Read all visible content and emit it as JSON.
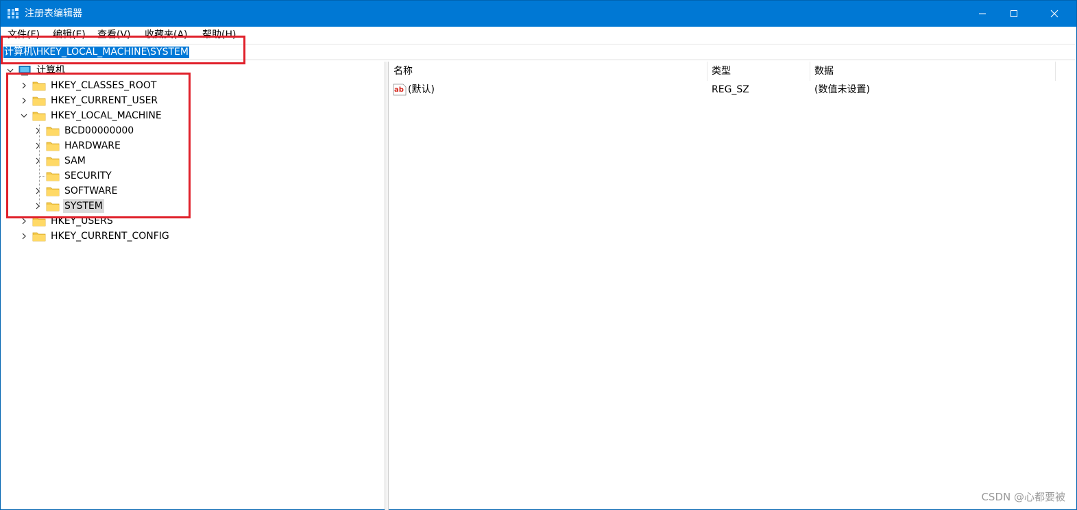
{
  "window": {
    "title": "注册表编辑器",
    "accent_color": "#0078d4"
  },
  "menu": [
    {
      "label": "文件(F)"
    },
    {
      "label": "编辑(E)"
    },
    {
      "label": "查看(V)"
    },
    {
      "label": "收藏夹(A)"
    },
    {
      "label": "帮助(H)"
    }
  ],
  "address": {
    "path": "计算机\\HKEY_LOCAL_MACHINE\\SYSTEM"
  },
  "tree": {
    "root": "计算机",
    "hives": [
      {
        "label": "HKEY_CLASSES_ROOT",
        "expanded": false
      },
      {
        "label": "HKEY_CURRENT_USER",
        "expanded": false
      },
      {
        "label": "HKEY_LOCAL_MACHINE",
        "expanded": true
      },
      {
        "label": "HKEY_USERS",
        "expanded": false
      },
      {
        "label": "HKEY_CURRENT_CONFIG",
        "expanded": false
      }
    ],
    "hklm_children": [
      {
        "label": "BCD00000000",
        "has_children": true
      },
      {
        "label": "HARDWARE",
        "has_children": true
      },
      {
        "label": "SAM",
        "has_children": true
      },
      {
        "label": "SECURITY",
        "has_children": false
      },
      {
        "label": "SOFTWARE",
        "has_children": true
      },
      {
        "label": "SYSTEM",
        "has_children": true,
        "selected": true
      }
    ]
  },
  "list": {
    "columns": [
      "名称",
      "类型",
      "数据"
    ],
    "rows": [
      {
        "name": "(默认)",
        "type": "REG_SZ",
        "data": "(数值未设置)",
        "icon": "string-value-icon"
      }
    ]
  },
  "highlight_color": "#e0202a",
  "watermark": "CSDN @心都要被"
}
